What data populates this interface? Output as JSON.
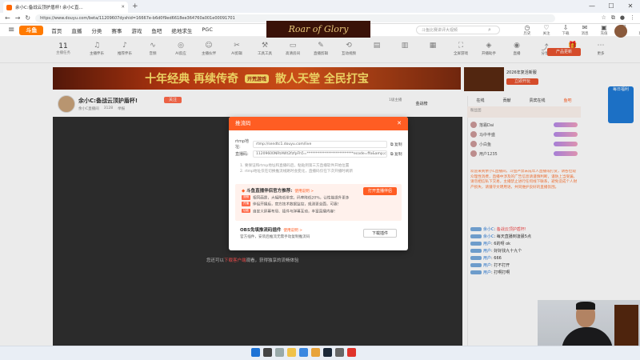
{
  "browser": {
    "tab_title": "余小C:备战云顶护盾杯! 余小C直...",
    "url": "https://www.douyu.com/beta/11209607dyshid=16667e-b6d0f9ed6618ee364760a001e00091701",
    "search_placeholder": "斗鱼比赛讲评大视频"
  },
  "site": {
    "logo": "斗鱼",
    "nav": [
      "首页",
      "直播",
      "分类",
      "赛事",
      "游戏",
      "鱼吧",
      "绝地求生",
      "PGC"
    ],
    "banner_game": "Roar of Glory",
    "header_icons": [
      "历史",
      "关注",
      "下载",
      "消息",
      "充值",
      "任务",
      "壮士"
    ]
  },
  "categories": {
    "date_num": "11",
    "date_label": "主播任务",
    "items": [
      "主播伴乐",
      "推荐伴乐",
      "音频",
      "AI反应",
      "主播伙伴",
      "AI剪辑",
      "工具工具",
      "高清房间",
      "直播剪辑",
      "互动视频",
      "",
      "",
      "",
      "全屏游戏",
      "开播助手",
      "直播",
      "分享",
      "礼物",
      "更多"
    ],
    "promo": "产品更新"
  },
  "ad": {
    "left": "十年经典 再续传奇",
    "badge": "开荒游戏",
    "right": "散人天堂 全民打宝",
    "side_title": "2026年复活新服",
    "side_btn": "立即开玩"
  },
  "room": {
    "title": "余小C:备战云顶护盾杯!",
    "follow": "关注",
    "sub": [
      "余小C直播间",
      "3128",
      "举报"
    ],
    "rank": "1级主播",
    "gold": "金战榜",
    "overlay_prefix": "您还可以",
    "overlay_link": "下载客户端",
    "overlay_suffix": "观看，获得独享的流畅体验"
  },
  "sidebar": {
    "tabs": [
      "在线",
      "贡献",
      "贵宾在线",
      "鱼吧"
    ],
    "fans": "粉丝团",
    "users": [
      "落霜Dai",
      "马中丰盛",
      "小白鱼",
      "用户1235"
    ],
    "notice": "欢迎来到余小C直播间，斗鱼严禁未成年人直播或打赏，请各位观众理性消费，直播中涉及的广告信息请谨慎判断，谨防上当受骗，请勿相信私下交易，主播禁止进行任何线下联系，避免造成个人财产损失，请遵守文明用语，共同维护良好的直播氛围。",
    "chat": [
      {
        "name": "余小C",
        "msg": "备战云顶护盾杯!"
      },
      {
        "name": "余小C",
        "msg": "每天直播到凌晨5点"
      },
      {
        "name": "用户",
        "msg": "6的呀 ok"
      },
      {
        "name": "用户",
        "msg": "好好找九十九个"
      },
      {
        "name": "用户",
        "msg": "666"
      },
      {
        "name": "用户",
        "msg": "打不打开"
      },
      {
        "name": "用户",
        "msg": "打啊打啊"
      }
    ],
    "float": "每日福利"
  },
  "modal": {
    "title": "推流码",
    "rtmp_label": "rtmp地址:",
    "rtmp_value": "rtmp://sendtc1.douyu.com/live",
    "code_label": "直播码:",
    "code_value": "11209600NRtAWt2fzfpFh5=**************************ecode=ffo&amp;cosmiro",
    "copy": "复制",
    "tips": [
      "1. 要保证和rtmp地址和直播码后，粘贴到第三方直播软件开始位置",
      "2. rtmp地址仅在切换推流线路时会变化，直播码仅在下次开播时刷新"
    ],
    "promo_title": "斗鱼直播伴侣官方推荐:",
    "promo_link": "使用说明 >",
    "promo_btn": "打开直播伴侣",
    "promo_tags": [
      "流畅",
      "开播",
      "功能"
    ],
    "promo_lines": [
      "相同画质，大幅降低带宽，码率降低20%，让性能提升更多",
      "伴侣开播后，官方技术数据监控，观测更全面，可靠!",
      "自定义屏幕布局、插件与弹幕互动，丰富直播内容!"
    ],
    "obs_title": "OBS免填推流码插件",
    "obs_link": "使用说明 >",
    "obs_desc": "官方插件，安装后推流无需手动复制推流码",
    "obs_btn": "下载插件"
  },
  "colors": {
    "accent": "#ff5d23",
    "dark_video": "#2f2f2f"
  }
}
